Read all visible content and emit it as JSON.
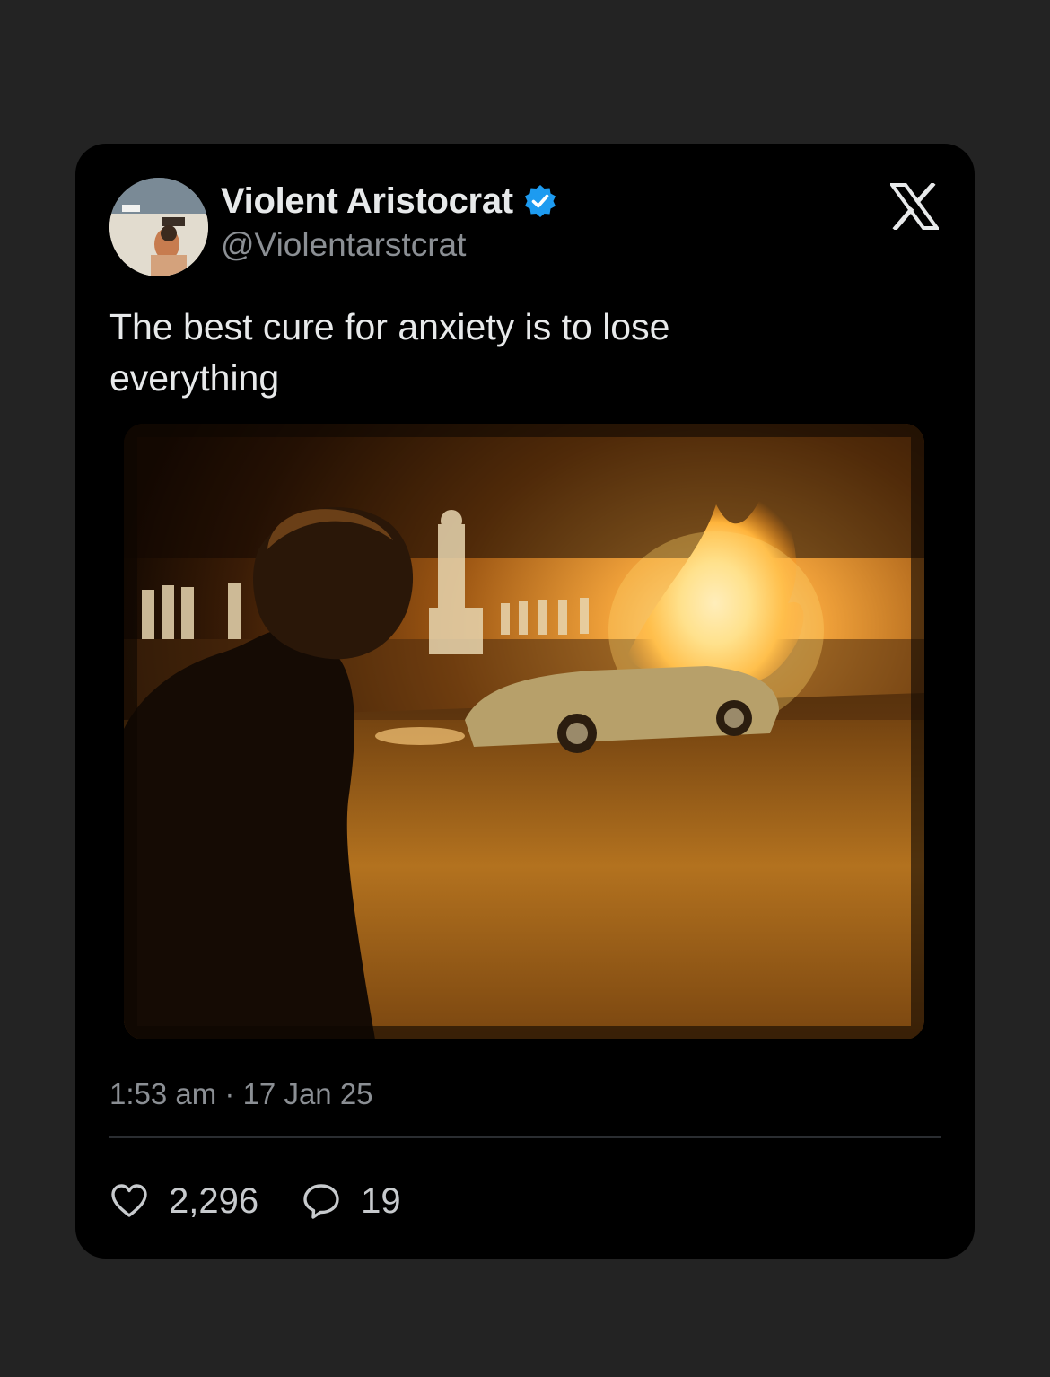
{
  "tweet": {
    "display_name": "Violent Aristocrat",
    "handle": "@Violentarstcrat",
    "verified": true,
    "text_line_1": "The best cure for anxiety is to lose",
    "text_line_2": "everything",
    "timestamp": "1:53 am · 17 Jan 25",
    "likes": "2,296",
    "replies": "19"
  },
  "colors": {
    "background": "#232323",
    "card": "#000000",
    "primary_text": "#e7e9ea",
    "secondary_text": "#8b8f94",
    "verified_badge": "#1d9bf0"
  },
  "icons": {
    "brand": "x-logo-icon",
    "verified": "verified-badge-icon",
    "like": "heart-icon",
    "reply": "comment-bubble-icon"
  }
}
